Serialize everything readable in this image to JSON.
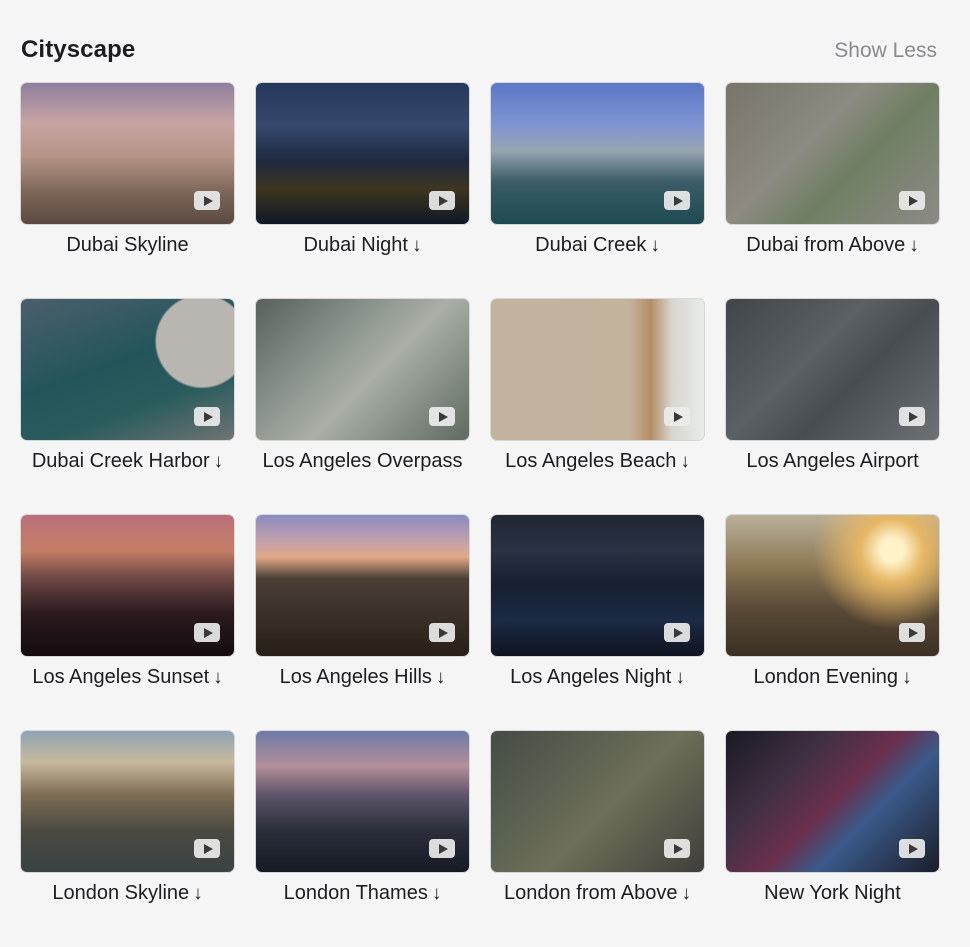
{
  "section": {
    "title": "Cityscape",
    "toggle_label": "Show Less"
  },
  "download_glyph": "↓",
  "icons": {
    "play": "play-icon",
    "download": "download-arrow-icon"
  },
  "videos": [
    {
      "label": "Dubai Skyline",
      "downloadable": false
    },
    {
      "label": "Dubai Night",
      "downloadable": true
    },
    {
      "label": "Dubai Creek",
      "downloadable": true
    },
    {
      "label": "Dubai from Above",
      "downloadable": true
    },
    {
      "label": "Dubai Creek Harbor",
      "downloadable": true
    },
    {
      "label": "Los Angeles Overpass",
      "downloadable": false
    },
    {
      "label": "Los Angeles Beach",
      "downloadable": true
    },
    {
      "label": "Los Angeles Airport",
      "downloadable": false
    },
    {
      "label": "Los Angeles Sunset",
      "downloadable": true
    },
    {
      "label": "Los Angeles Hills",
      "downloadable": true
    },
    {
      "label": "Los Angeles Night",
      "downloadable": true
    },
    {
      "label": "London Evening",
      "downloadable": true
    },
    {
      "label": "London Skyline",
      "downloadable": true
    },
    {
      "label": "London Thames",
      "downloadable": true
    },
    {
      "label": "London from Above",
      "downloadable": true
    },
    {
      "label": "New York Night",
      "downloadable": false
    }
  ]
}
